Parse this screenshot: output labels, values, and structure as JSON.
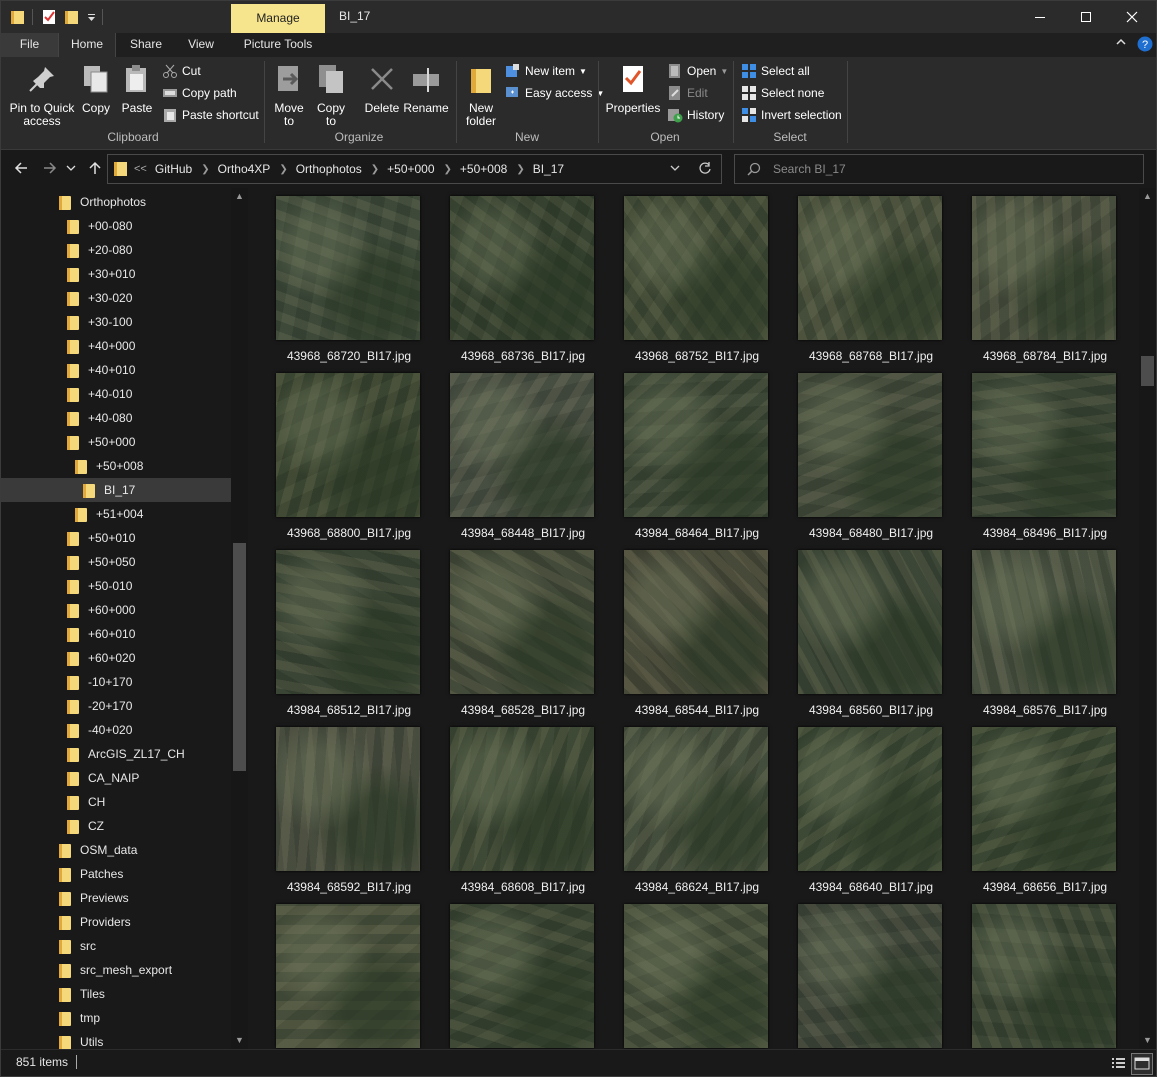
{
  "titlebar": {
    "context_tab": "Manage",
    "title": "BI_17",
    "quick_access": [
      "folder-icon",
      "properties-check-icon",
      "new-folder-icon",
      "customize-dropdown-icon"
    ],
    "minimize_icon": "minimize-icon",
    "maximize_icon": "maximize-icon",
    "close_icon": "close-icon"
  },
  "ribbon_tabs": [
    "File",
    "Home",
    "Share",
    "View",
    "Picture Tools"
  ],
  "ribbon": {
    "clipboard": {
      "label": "Clipboard",
      "pin": "Pin to Quick\naccess",
      "copy": "Copy",
      "paste": "Paste",
      "cut": "Cut",
      "copy_path": "Copy path",
      "paste_shortcut": "Paste shortcut"
    },
    "organize": {
      "label": "Organize",
      "move_to": "Move\nto",
      "copy_to": "Copy\nto",
      "delete": "Delete",
      "rename": "Rename"
    },
    "new": {
      "label": "New",
      "new_folder": "New\nfolder",
      "new_item": "New item",
      "easy_access": "Easy access"
    },
    "open": {
      "label": "Open",
      "properties": "Properties",
      "open": "Open",
      "edit": "Edit",
      "history": "History"
    },
    "select": {
      "label": "Select",
      "select_all": "Select all",
      "select_none": "Select none",
      "invert": "Invert selection"
    }
  },
  "address": {
    "overflow": "<<",
    "crumbs": [
      "GitHub",
      "Ortho4XP",
      "Orthophotos",
      "+50+000",
      "+50+008",
      "BI_17"
    ]
  },
  "search": {
    "placeholder": "Search BI_17"
  },
  "tree": [
    {
      "label": "Orthophotos",
      "level": 0,
      "selected": false
    },
    {
      "label": "+00-080",
      "level": 1,
      "selected": false
    },
    {
      "label": "+20-080",
      "level": 1,
      "selected": false
    },
    {
      "label": "+30+010",
      "level": 1,
      "selected": false
    },
    {
      "label": "+30-020",
      "level": 1,
      "selected": false
    },
    {
      "label": "+30-100",
      "level": 1,
      "selected": false
    },
    {
      "label": "+40+000",
      "level": 1,
      "selected": false
    },
    {
      "label": "+40+010",
      "level": 1,
      "selected": false
    },
    {
      "label": "+40-010",
      "level": 1,
      "selected": false
    },
    {
      "label": "+40-080",
      "level": 1,
      "selected": false
    },
    {
      "label": "+50+000",
      "level": 1,
      "selected": false
    },
    {
      "label": "+50+008",
      "level": 2,
      "selected": false
    },
    {
      "label": "BI_17",
      "level": 3,
      "selected": true
    },
    {
      "label": "+51+004",
      "level": 2,
      "selected": false
    },
    {
      "label": "+50+010",
      "level": 1,
      "selected": false
    },
    {
      "label": "+50+050",
      "level": 1,
      "selected": false
    },
    {
      "label": "+50-010",
      "level": 1,
      "selected": false
    },
    {
      "label": "+60+000",
      "level": 1,
      "selected": false
    },
    {
      "label": "+60+010",
      "level": 1,
      "selected": false
    },
    {
      "label": "+60+020",
      "level": 1,
      "selected": false
    },
    {
      "label": "-10+170",
      "level": 1,
      "selected": false
    },
    {
      "label": "-20+170",
      "level": 1,
      "selected": false
    },
    {
      "label": "-40+020",
      "level": 1,
      "selected": false
    },
    {
      "label": "ArcGIS_ZL17_CH",
      "level": 1,
      "selected": false
    },
    {
      "label": "CA_NAIP",
      "level": 1,
      "selected": false
    },
    {
      "label": "CH",
      "level": 1,
      "selected": false
    },
    {
      "label": "CZ",
      "level": 1,
      "selected": false
    },
    {
      "label": "OSM_data",
      "level": 0,
      "selected": false
    },
    {
      "label": "Patches",
      "level": 0,
      "selected": false
    },
    {
      "label": "Previews",
      "level": 0,
      "selected": false
    },
    {
      "label": "Providers",
      "level": 0,
      "selected": false
    },
    {
      "label": "src",
      "level": 0,
      "selected": false
    },
    {
      "label": "src_mesh_export",
      "level": 0,
      "selected": false
    },
    {
      "label": "Tiles",
      "level": 0,
      "selected": false
    },
    {
      "label": "tmp",
      "level": 0,
      "selected": false
    },
    {
      "label": "Utils",
      "level": 0,
      "selected": false
    }
  ],
  "files": [
    {
      "name": "43968_68720_BI17.jpg",
      "tone": "#3e4a3b"
    },
    {
      "name": "43968_68736_BI17.jpg",
      "tone": "#34402f"
    },
    {
      "name": "43968_68752_BI17.jpg",
      "tone": "#404a36"
    },
    {
      "name": "43968_68768_BI17.jpg",
      "tone": "#48503c"
    },
    {
      "name": "43968_68784_BI17.jpg",
      "tone": "#4a5040"
    },
    {
      "name": "43968_68800_BI17.jpg",
      "tone": "#3a4531"
    },
    {
      "name": "43984_68448_BI17.jpg",
      "tone": "#4a5046"
    },
    {
      "name": "43984_68464_BI17.jpg",
      "tone": "#3c4737"
    },
    {
      "name": "43984_68480_BI17.jpg",
      "tone": "#434b3c"
    },
    {
      "name": "43984_68496_BI17.jpg",
      "tone": "#394435"
    },
    {
      "name": "43984_68512_BI17.jpg",
      "tone": "#3b4536"
    },
    {
      "name": "43984_68528_BI17.jpg",
      "tone": "#454b3b"
    },
    {
      "name": "43984_68544_BI17.jpg",
      "tone": "#4a4a3b"
    },
    {
      "name": "43984_68560_BI17.jpg",
      "tone": "#3d4738"
    },
    {
      "name": "43984_68576_BI17.jpg",
      "tone": "#4a5243"
    },
    {
      "name": "43984_68592_BI17.jpg",
      "tone": "#4b4f42"
    },
    {
      "name": "43984_68608_BI17.jpg",
      "tone": "#3f4a37"
    },
    {
      "name": "43984_68624_BI17.jpg",
      "tone": "#47503f"
    },
    {
      "name": "43984_68640_BI17.jpg",
      "tone": "#3d4a36"
    },
    {
      "name": "43984_68656_BI17.jpg",
      "tone": "#3a4733"
    },
    {
      "name": "",
      "tone": "#4a513e"
    },
    {
      "name": "",
      "tone": "#394433"
    },
    {
      "name": "",
      "tone": "#47503d"
    },
    {
      "name": "",
      "tone": "#3f463c"
    },
    {
      "name": "",
      "tone": "#3a4535"
    }
  ],
  "status": {
    "count": "851 items"
  },
  "colors": {
    "manage_tab": "#f6e58c",
    "folder": "#f5d87a",
    "accent": "#0078d7"
  }
}
